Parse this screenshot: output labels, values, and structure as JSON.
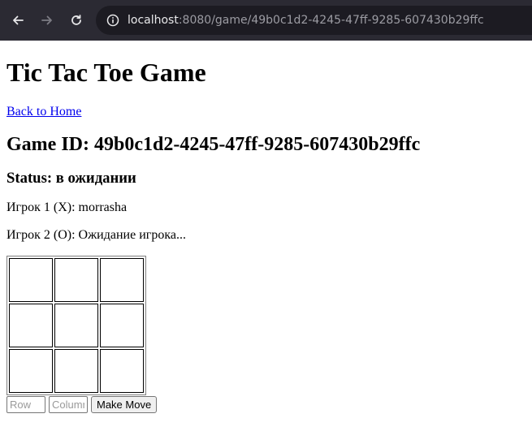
{
  "browser": {
    "url_host": "localhost",
    "url_path": ":8080/game/49b0c1d2-4245-47ff-9285-607430b29ffc"
  },
  "page": {
    "title": "Tic Tac Toe Game",
    "home_link": "Back to Home",
    "game_id_heading": "Game ID: 49b0c1d2-4245-47ff-9285-607430b29ffc",
    "status_heading": "Status: в ожидании",
    "player1": "Игрок 1 (X): morrasha",
    "player2": "Игрок 2 (O): Ожидание игрока..."
  },
  "board": {
    "cells": [
      [
        "",
        "",
        ""
      ],
      [
        "",
        "",
        ""
      ],
      [
        "",
        "",
        ""
      ]
    ]
  },
  "move_form": {
    "row_placeholder": "Row",
    "column_placeholder": "Column",
    "row_value": "",
    "column_value": "",
    "submit_label": "Make Move"
  }
}
